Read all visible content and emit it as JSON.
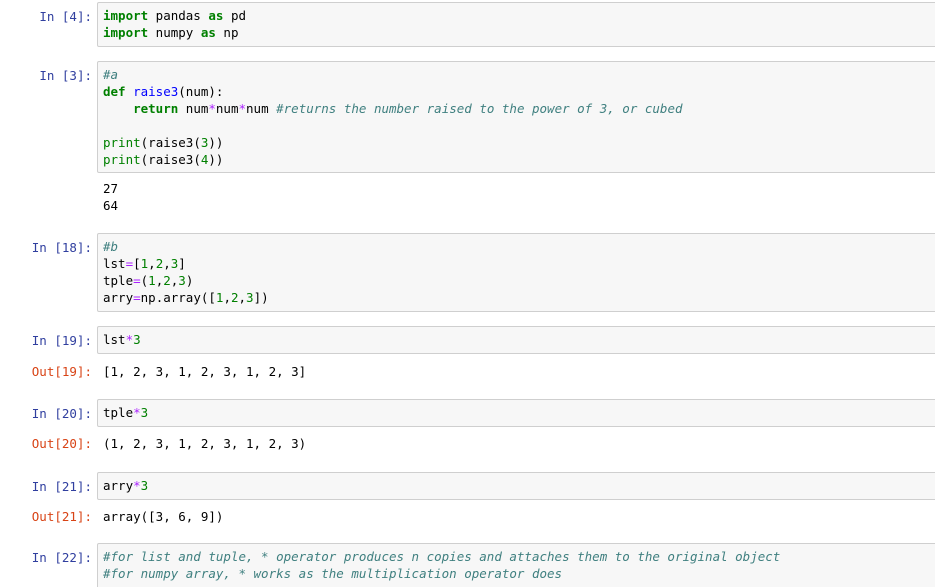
{
  "cells": [
    {
      "in_prompt": "In [4]:",
      "code": [
        [
          {
            "t": "import",
            "c": "kw"
          },
          {
            "t": " pandas ",
            "c": ""
          },
          {
            "t": "as",
            "c": "kw"
          },
          {
            "t": " pd",
            "c": ""
          }
        ],
        [
          {
            "t": "import",
            "c": "kw"
          },
          {
            "t": " numpy ",
            "c": ""
          },
          {
            "t": "as",
            "c": "kw"
          },
          {
            "t": " np",
            "c": ""
          }
        ]
      ]
    },
    {
      "in_prompt": "In [3]:",
      "code": [
        [
          {
            "t": "#a",
            "c": "cm"
          }
        ],
        [
          {
            "t": "def",
            "c": "kw"
          },
          {
            "t": " ",
            "c": ""
          },
          {
            "t": "raise3",
            "c": "fn"
          },
          {
            "t": "(num):",
            "c": ""
          }
        ],
        [
          {
            "t": "    ",
            "c": ""
          },
          {
            "t": "return",
            "c": "kw"
          },
          {
            "t": " num",
            "c": ""
          },
          {
            "t": "*",
            "c": "op"
          },
          {
            "t": "num",
            "c": ""
          },
          {
            "t": "*",
            "c": "op"
          },
          {
            "t": "num ",
            "c": ""
          },
          {
            "t": "#returns the number raised to the power of 3, or cubed",
            "c": "cm"
          }
        ],
        [
          {
            "t": "",
            "c": ""
          }
        ],
        [
          {
            "t": "print",
            "c": "bi"
          },
          {
            "t": "(raise3(",
            "c": ""
          },
          {
            "t": "3",
            "c": "num"
          },
          {
            "t": "))",
            "c": ""
          }
        ],
        [
          {
            "t": "print",
            "c": "bi"
          },
          {
            "t": "(raise3(",
            "c": ""
          },
          {
            "t": "4",
            "c": "num"
          },
          {
            "t": "))",
            "c": ""
          }
        ]
      ],
      "output": [
        "27",
        "64"
      ]
    },
    {
      "in_prompt": "In [18]:",
      "code": [
        [
          {
            "t": "#b",
            "c": "cm"
          }
        ],
        [
          {
            "t": "lst",
            "c": ""
          },
          {
            "t": "=",
            "c": "op"
          },
          {
            "t": "[",
            "c": ""
          },
          {
            "t": "1",
            "c": "num"
          },
          {
            "t": ",",
            "c": ""
          },
          {
            "t": "2",
            "c": "num"
          },
          {
            "t": ",",
            "c": ""
          },
          {
            "t": "3",
            "c": "num"
          },
          {
            "t": "]",
            "c": ""
          }
        ],
        [
          {
            "t": "tple",
            "c": ""
          },
          {
            "t": "=",
            "c": "op"
          },
          {
            "t": "(",
            "c": ""
          },
          {
            "t": "1",
            "c": "num"
          },
          {
            "t": ",",
            "c": ""
          },
          {
            "t": "2",
            "c": "num"
          },
          {
            "t": ",",
            "c": ""
          },
          {
            "t": "3",
            "c": "num"
          },
          {
            "t": ")",
            "c": ""
          }
        ],
        [
          {
            "t": "arry",
            "c": ""
          },
          {
            "t": "=",
            "c": "op"
          },
          {
            "t": "np.array([",
            "c": ""
          },
          {
            "t": "1",
            "c": "num"
          },
          {
            "t": ",",
            "c": ""
          },
          {
            "t": "2",
            "c": "num"
          },
          {
            "t": ",",
            "c": ""
          },
          {
            "t": "3",
            "c": "num"
          },
          {
            "t": "])",
            "c": ""
          }
        ]
      ]
    },
    {
      "in_prompt": "In [19]:",
      "code": [
        [
          {
            "t": "lst",
            "c": ""
          },
          {
            "t": "*",
            "c": "op"
          },
          {
            "t": "3",
            "c": "num"
          }
        ]
      ],
      "out_prompt": "Out[19]:",
      "output": [
        "[1, 2, 3, 1, 2, 3, 1, 2, 3]"
      ]
    },
    {
      "in_prompt": "In [20]:",
      "code": [
        [
          {
            "t": "tple",
            "c": ""
          },
          {
            "t": "*",
            "c": "op"
          },
          {
            "t": "3",
            "c": "num"
          }
        ]
      ],
      "out_prompt": "Out[20]:",
      "output": [
        "(1, 2, 3, 1, 2, 3, 1, 2, 3)"
      ]
    },
    {
      "in_prompt": "In [21]:",
      "code": [
        [
          {
            "t": "arry",
            "c": ""
          },
          {
            "t": "*",
            "c": "op"
          },
          {
            "t": "3",
            "c": "num"
          }
        ]
      ],
      "out_prompt": "Out[21]:",
      "output": [
        "array([3, 6, 9])"
      ]
    },
    {
      "in_prompt": "In [22]:",
      "code": [
        [
          {
            "t": "#for list and tuple, * operator produces n copies and attaches them to the original object",
            "c": "cm"
          }
        ],
        [
          {
            "t": "#for numpy array, * works as the multiplication operator does",
            "c": "cm"
          }
        ]
      ]
    }
  ]
}
